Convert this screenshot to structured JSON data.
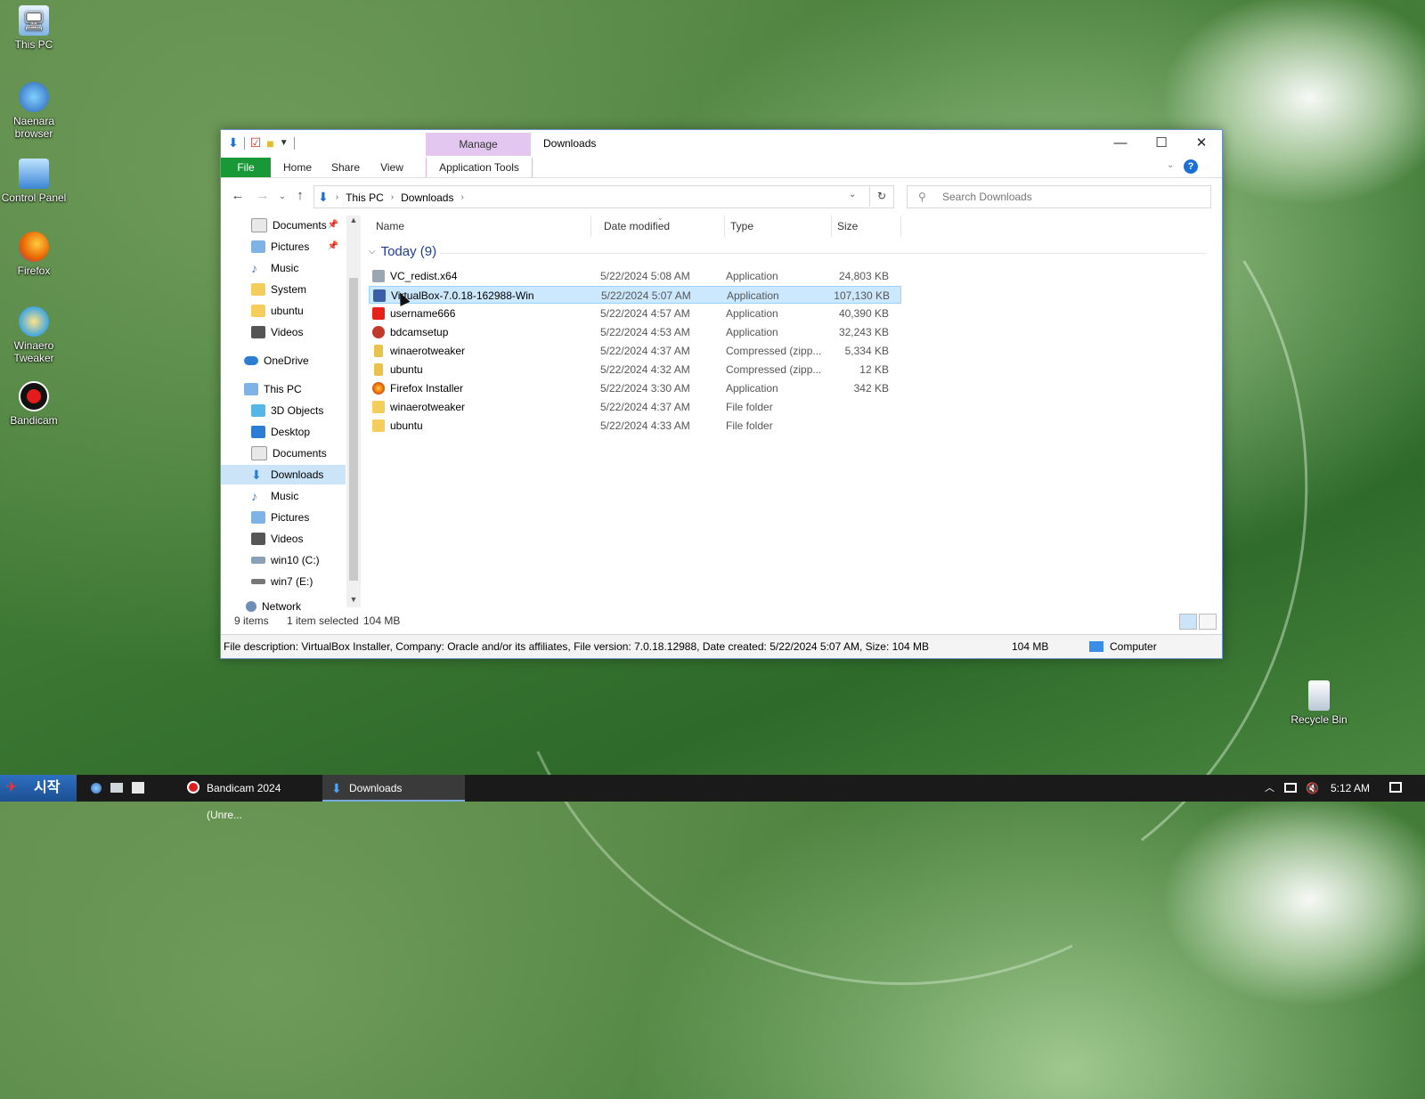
{
  "desktop": {
    "icons": [
      {
        "label": "This PC",
        "icon": "pc-icon"
      },
      {
        "label": "Naenara browser",
        "icon": "naenara-browser-icon"
      },
      {
        "label": "Control Panel",
        "icon": "control-panel-icon"
      },
      {
        "label": "Firefox",
        "icon": "firefox-icon"
      },
      {
        "label": "Winaero Tweaker",
        "icon": "winaero-tweaker-icon"
      },
      {
        "label": "Bandicam",
        "icon": "bandicam-icon"
      },
      {
        "label": "Recycle Bin",
        "icon": "recycle-bin-icon"
      }
    ]
  },
  "window": {
    "title": "Downloads",
    "context_tab": "Manage",
    "tabs": {
      "file": "File",
      "home": "Home",
      "share": "Share",
      "view": "View",
      "app_tools": "Application Tools"
    },
    "address": {
      "crumbs": [
        "This PC",
        "Downloads"
      ]
    },
    "search_placeholder": "Search Downloads",
    "nav_items": [
      {
        "label": "Documents",
        "icon": "documents-icon",
        "color": "#e8e8e8",
        "pinned": true
      },
      {
        "label": "Pictures",
        "icon": "pictures-icon",
        "color": "#7fb3e6",
        "pinned": true
      },
      {
        "label": "Music",
        "icon": "music-icon",
        "color": "#3a7bd5",
        "pinned": false
      },
      {
        "label": "System",
        "icon": "folder-icon",
        "color": "#f4cd5a",
        "pinned": false
      },
      {
        "label": "ubuntu",
        "icon": "folder-icon",
        "color": "#f4cd5a",
        "pinned": false
      },
      {
        "label": "Videos",
        "icon": "videos-icon",
        "color": "#555555",
        "pinned": false
      },
      {
        "label": "OneDrive",
        "icon": "onedrive-icon",
        "color": "#2b7cd3",
        "pinned": false
      },
      {
        "label": "This PC",
        "icon": "pc-icon",
        "color": "#7fb3e6",
        "pinned": false
      },
      {
        "label": "3D Objects",
        "icon": "3d-objects-icon",
        "color": "#56b7e6",
        "pinned": false
      },
      {
        "label": "Desktop",
        "icon": "desktop-icon",
        "color": "#2b7cd3",
        "pinned": false
      },
      {
        "label": "Documents",
        "icon": "documents-icon",
        "color": "#e8e8e8",
        "pinned": false
      },
      {
        "label": "Downloads",
        "icon": "downloads-icon",
        "color": "#2b7cd3",
        "pinned": false,
        "selected": true
      },
      {
        "label": "Music",
        "icon": "music-icon",
        "color": "#3a7bd5",
        "pinned": false
      },
      {
        "label": "Pictures",
        "icon": "pictures-icon",
        "color": "#7fb3e6",
        "pinned": false
      },
      {
        "label": "Videos",
        "icon": "videos-icon",
        "color": "#555555",
        "pinned": false
      },
      {
        "label": "win10 (C:)",
        "icon": "drive-icon",
        "color": "#8aa0b8",
        "pinned": false
      },
      {
        "label": "win7 (E:)",
        "icon": "drive-icon",
        "color": "#777777",
        "pinned": false
      },
      {
        "label": "Network",
        "icon": "network-icon",
        "color": "#6d8fb5",
        "pinned": false
      }
    ],
    "columns": {
      "name": "Name",
      "date": "Date modified",
      "type": "Type",
      "size": "Size"
    },
    "group_label": "Today (9)",
    "files": [
      {
        "name": "VC_redist.x64",
        "date": "5/22/2024 5:08 AM",
        "type": "Application",
        "size": "24,803 KB",
        "icon": "installer-icon",
        "color": "#9aa6b2"
      },
      {
        "name": "VirtualBox-7.0.18-162988-Win",
        "date": "5/22/2024 5:07 AM",
        "type": "Application",
        "size": "107,130 KB",
        "icon": "virtualbox-icon",
        "color": "#3b5ea8",
        "selected": true
      },
      {
        "name": "username666",
        "date": "5/22/2024 4:57 AM",
        "type": "Application",
        "size": "40,390 KB",
        "icon": "youtube-icon",
        "color": "#e62117"
      },
      {
        "name": "bdcamsetup",
        "date": "5/22/2024 4:53 AM",
        "type": "Application",
        "size": "32,243 KB",
        "icon": "bandicam-icon",
        "color": "#c0392b"
      },
      {
        "name": "winaerotweaker",
        "date": "5/22/2024 4:37 AM",
        "type": "Compressed (zipp...",
        "size": "5,334 KB",
        "icon": "zip-folder-icon",
        "color": "#e8c24a"
      },
      {
        "name": "ubuntu",
        "date": "5/22/2024 4:32 AM",
        "type": "Compressed (zipp...",
        "size": "12 KB",
        "icon": "zip-folder-icon",
        "color": "#e8c24a"
      },
      {
        "name": "Firefox Installer",
        "date": "5/22/2024 3:30 AM",
        "type": "Application",
        "size": "342 KB",
        "icon": "firefox-icon",
        "color": "#e66000"
      },
      {
        "name": "winaerotweaker",
        "date": "5/22/2024 4:37 AM",
        "type": "File folder",
        "size": "",
        "icon": "folder-icon",
        "color": "#f4cd5a"
      },
      {
        "name": "ubuntu",
        "date": "5/22/2024 4:33 AM",
        "type": "File folder",
        "size": "",
        "icon": "folder-icon",
        "color": "#f4cd5a"
      }
    ],
    "status": {
      "count": "9 items",
      "selected": "1 item selected",
      "size": "104 MB"
    },
    "details": {
      "description": "File description: VirtualBox Installer, Company: Oracle and/or its affiliates, File version: 7.0.18.12988, Date created: 5/22/2024 5:07 AM, Size: 104 MB",
      "size": "104 MB",
      "location": "Computer"
    }
  },
  "taskbar": {
    "start_label": "시작",
    "tasks": [
      {
        "label": "Bandicam 2024 (Unre...",
        "icon": "bandicam-icon"
      },
      {
        "label": "Downloads",
        "icon": "downloads-icon",
        "active": true
      }
    ],
    "clock": "5:12 AM"
  }
}
